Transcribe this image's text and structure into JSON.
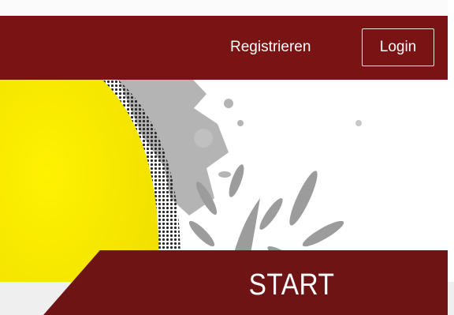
{
  "nav": {
    "register_label": "Registrieren",
    "login_label": "Login"
  },
  "hero": {
    "start_label": "START"
  },
  "colors": {
    "navbar": "#7a1313",
    "banner": "#6e1414",
    "sun_yellow": "#f5e600",
    "splatter_gray": "#a8a8a8"
  }
}
